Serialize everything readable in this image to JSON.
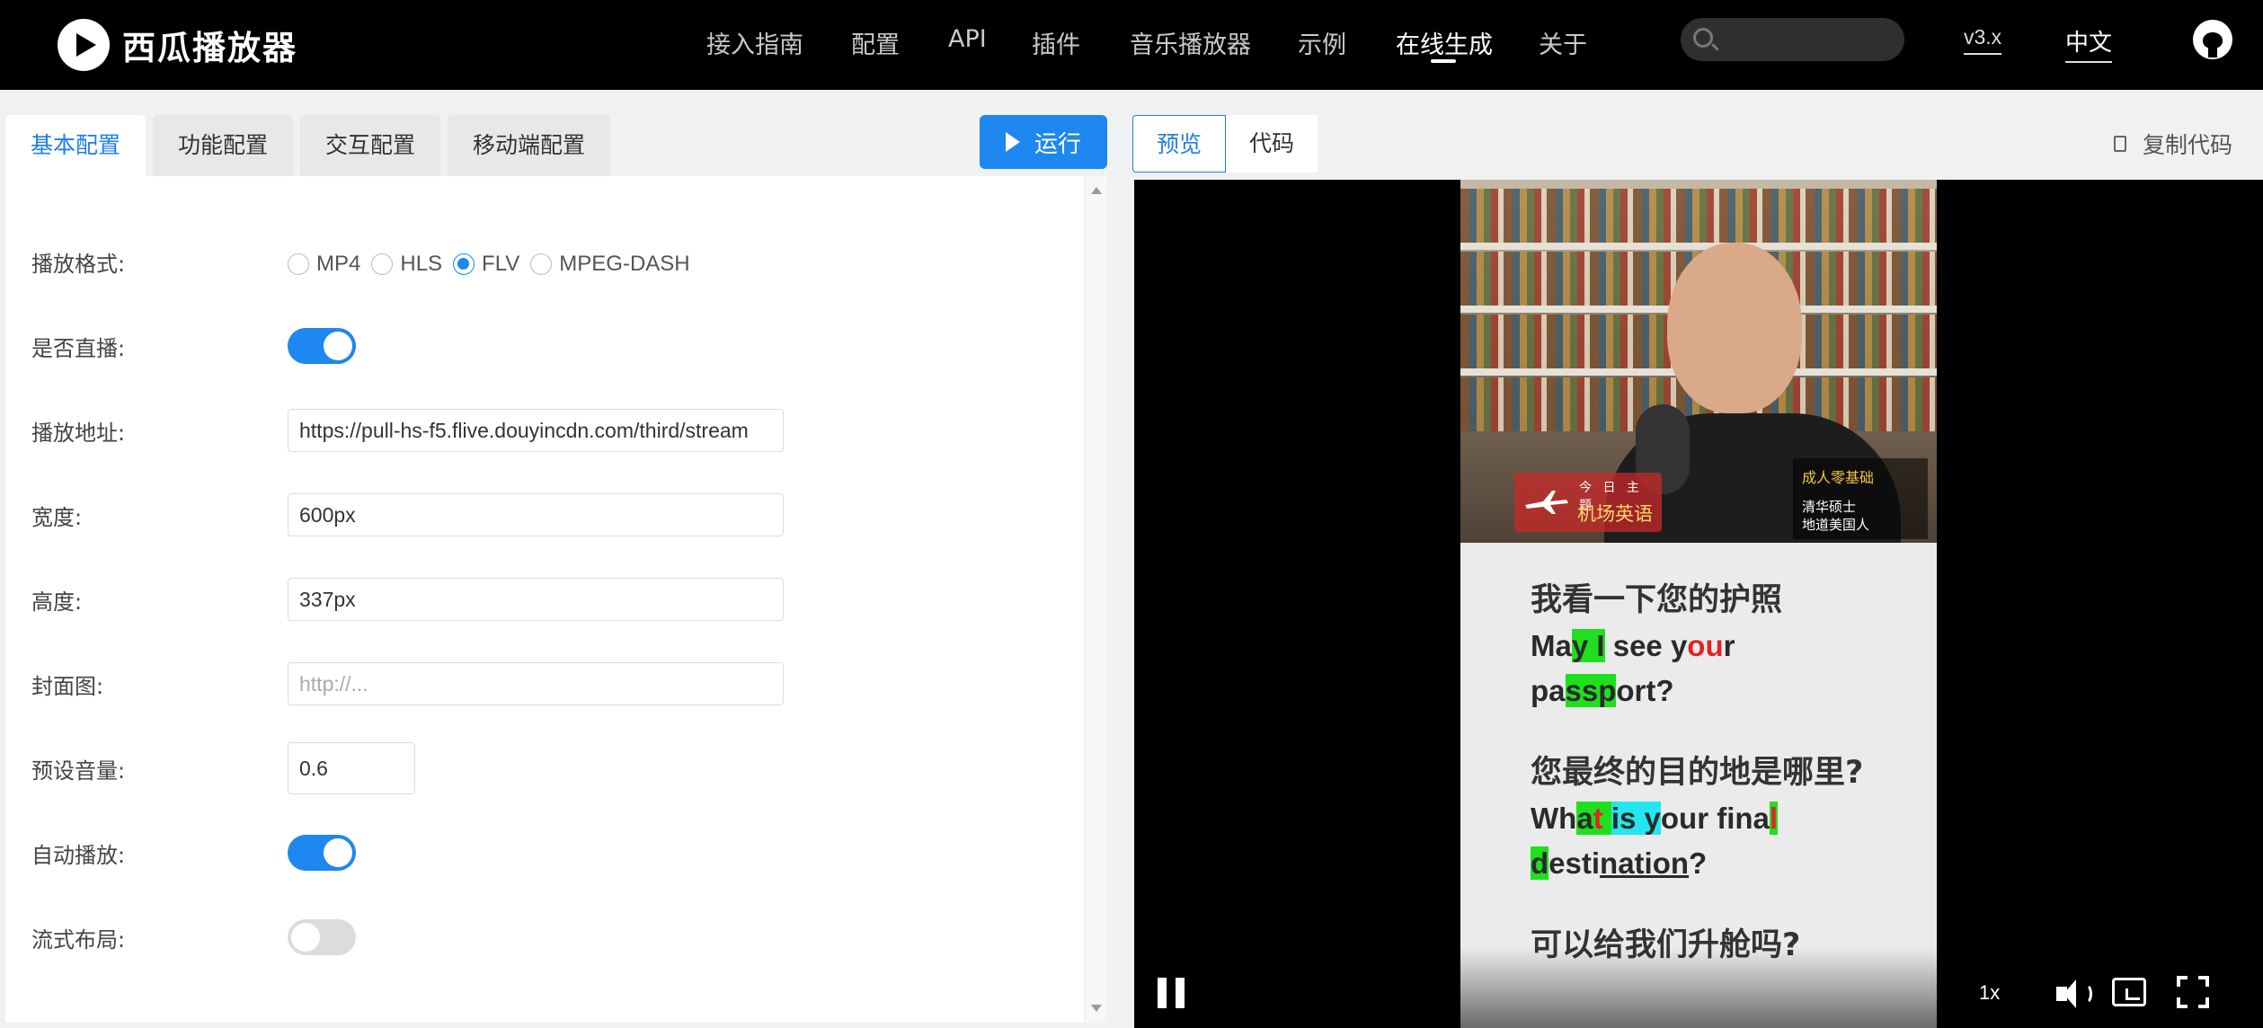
{
  "brand": {
    "name": "西瓜播放器"
  },
  "nav": {
    "items": [
      "接入指南",
      "配置",
      "API",
      "插件",
      "音乐播放器",
      "示例",
      "在线生成",
      "关于"
    ],
    "active": "在线生成",
    "search_placeholder": "",
    "version": "v3.x",
    "language": "中文"
  },
  "left": {
    "tabs": [
      "基本配置",
      "功能配置",
      "交互配置",
      "移动端配置"
    ],
    "active_tab": "基本配置",
    "run_label": "运行",
    "fields": {
      "format": {
        "label": "播放格式:",
        "options": [
          "MP4",
          "HLS",
          "FLV",
          "MPEG-DASH"
        ],
        "selected": "FLV"
      },
      "live": {
        "label": "是否直播:",
        "on": true
      },
      "url": {
        "label": "播放地址:",
        "value": "https://pull-hs-f5.flive.douyincdn.com/third/stream"
      },
      "width": {
        "label": "宽度:",
        "value": "600px"
      },
      "height": {
        "label": "高度:",
        "value": "337px"
      },
      "poster": {
        "label": "封面图:",
        "placeholder": "http://..."
      },
      "volume": {
        "label": "预设音量:",
        "value": "0.6"
      },
      "autoplay": {
        "label": "自动播放:",
        "on": true
      },
      "fluid": {
        "label": "流式布局:",
        "on": false
      }
    }
  },
  "right": {
    "tabs": [
      "预览",
      "代码"
    ],
    "active_tab": "预览",
    "copy_label": "复制代码",
    "video": {
      "badge_topic_small": "今 日 主 题",
      "badge_topic": "机场英语",
      "badge_right_title": "成人零基础",
      "badge_right_line1": "清华硕士",
      "badge_right_line2": "地道美国人",
      "zh1": "我看一下您的护照",
      "zh2": "您最终的目的地是哪里?",
      "zh3": "可以给我们升舱吗?"
    },
    "controls": {
      "rate": "1x"
    }
  },
  "colors": {
    "accent": "#1e87f0",
    "topbar": "#000000"
  }
}
